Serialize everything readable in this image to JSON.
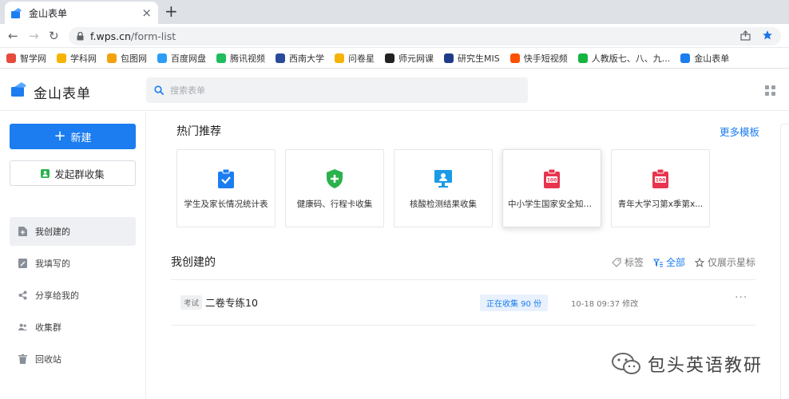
{
  "browser": {
    "tab": {
      "title": "金山表单",
      "close": "×"
    },
    "new_tab": "+",
    "url_host": "f.wps.cn",
    "url_path": "/form-list",
    "bookmarks": [
      {
        "label": "智学网",
        "icon": "zhixue-icon",
        "color": "#e64b3c"
      },
      {
        "label": "学科网",
        "icon": "xueke-icon",
        "color": "#f6b400"
      },
      {
        "label": "包图网",
        "icon": "baotu-icon",
        "color": "#f2a20c"
      },
      {
        "label": "百度网盘",
        "icon": "baidupan-icon",
        "color": "#2d9cf5"
      },
      {
        "label": "腾讯视频",
        "icon": "tencent-video-icon",
        "color": "#1fbd5d"
      },
      {
        "label": "西南大学",
        "icon": "swu-icon",
        "color": "#2a4a9a"
      },
      {
        "label": "问卷星",
        "icon": "star-icon",
        "color": "#f5b400"
      },
      {
        "label": "师元网课",
        "icon": "shiyuan-icon",
        "color": "#222222"
      },
      {
        "label": "研究生MIS",
        "icon": "mis-icon",
        "color": "#1f3c88"
      },
      {
        "label": "快手短视频",
        "icon": "kuaishou-icon",
        "color": "#ff5000"
      },
      {
        "label": "人教版七、八、九...",
        "icon": "wechat-icon",
        "color": "#15b441"
      },
      {
        "label": "金山表单",
        "icon": "wps-form-icon",
        "color": "#1b7df0"
      }
    ]
  },
  "app": {
    "brand": "金山表单",
    "search_placeholder": "搜索表单",
    "accent_color": "#1b7df0"
  },
  "sidebar": {
    "new_button": "新建",
    "group_button": "发起群收集",
    "nav": [
      {
        "label": "我创建的",
        "icon": "file-icon",
        "active": true
      },
      {
        "label": "我填写的",
        "icon": "edit-icon",
        "active": false
      },
      {
        "label": "分享给我的",
        "icon": "share-icon",
        "active": false
      },
      {
        "label": "收集群",
        "icon": "group-icon",
        "active": false
      },
      {
        "label": "回收站",
        "icon": "trash-icon",
        "active": false
      }
    ]
  },
  "recommend": {
    "title": "热门推荐",
    "more": "更多模板",
    "cards": [
      {
        "label": "学生及家长情况统计表",
        "icon": "clipboard-check-icon",
        "color": "#1b7df0"
      },
      {
        "label": "健康码、行程卡收集",
        "icon": "health-shield-icon",
        "color": "#2bb24c"
      },
      {
        "label": "核酸检测结果收集",
        "icon": "monitor-icon",
        "color": "#1a9be6"
      },
      {
        "label": "中小学生国家安全知识...",
        "icon": "score-100-icon",
        "color": "#e8344e"
      },
      {
        "label": "青年大学习第x季第x...",
        "icon": "score-100-icon",
        "color": "#e8344e"
      }
    ]
  },
  "mine": {
    "title": "我创建的",
    "tools": {
      "tags": "标签",
      "all": "全部",
      "starred": "仅展示星标"
    },
    "forms": [
      {
        "tag": "考试",
        "name": "二卷专练10",
        "status": "正在收集 90 份",
        "modified": "10-18 09:37 修改",
        "more": "···"
      }
    ]
  },
  "watermark": "包头英语教研"
}
